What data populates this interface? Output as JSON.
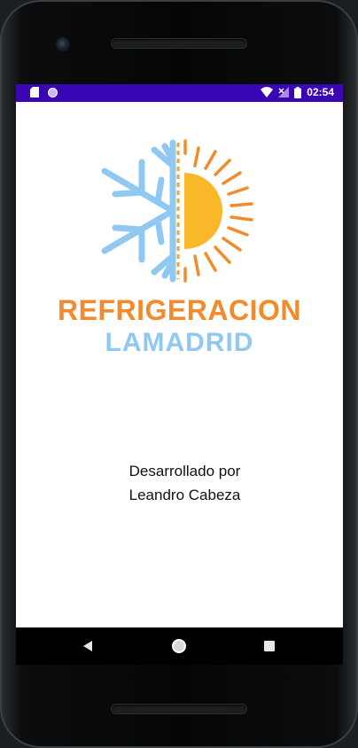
{
  "status_bar": {
    "time": "02:54",
    "icons": [
      "sd-card-icon",
      "notification-dot-icon",
      "wifi-icon",
      "signal-icon",
      "battery-icon"
    ],
    "color": "#3a06b4"
  },
  "brand": {
    "line1": "REFRIGERACION",
    "line2": "LAMADRID",
    "line1_color": "#f28b2c",
    "line2_color": "#8fc8f0"
  },
  "credits": {
    "line1": "Desarrollado por",
    "line2": "Leandro Cabeza"
  },
  "nav_bar": {
    "icons": [
      "back-icon",
      "home-icon",
      "recents-icon"
    ]
  }
}
